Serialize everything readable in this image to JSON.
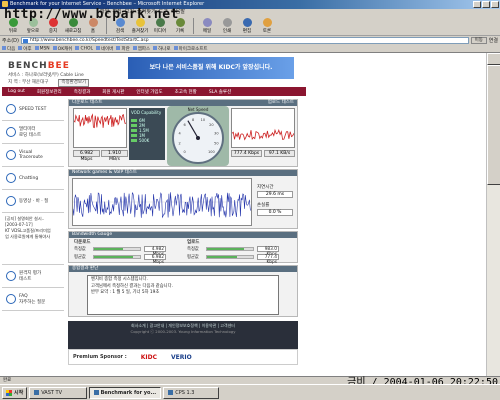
{
  "window": {
    "title": "Benchmark for your Internet Service – Benchbee – Microsoft Internet Explorer"
  },
  "watermark": "http://www.bcpark.net",
  "menu": [
    "파일",
    "편집",
    "보기",
    "즐겨찾기",
    "도구",
    "도움말"
  ],
  "toolbar": [
    "뒤로",
    "앞으로",
    "중지",
    "새로고침",
    "홈",
    "검색",
    "즐겨찾기",
    "미디어",
    "기록",
    "메일",
    "인쇄",
    "편집",
    "토론"
  ],
  "address": {
    "label": "주소(D)",
    "url": "http://www.benchbee.co.kr/Speedtest/TestStartC.asp",
    "go": "이동",
    "links": "연결"
  },
  "links": [
    "다음",
    "야후",
    "MSN",
    "OK캐쉬",
    "CHOL",
    "네이버",
    "파란",
    "엠파스",
    "하나로",
    "마이크로소프트"
  ],
  "site": {
    "logo_a": "BENCH",
    "logo_b": "BEE",
    "info": [
      "서비스 : 하나로(보라넷/무) Cable Line",
      "지 역 : 부산 해운대구"
    ],
    "info_button": "측정환경보기",
    "banner": "보다 나은 서비스품질 위해 KIDC가 앞장섭니다."
  },
  "nav": [
    "Log out",
    "회원정보관리",
    "측정결과",
    "회원 게시판",
    "인터넷 가입도",
    "초고속 현황",
    "SLA 솔루션"
  ],
  "sidebar": [
    "SPEED TEST",
    "멀티미터\n로딩 테스트",
    "Visual\nTraceroute",
    "Chatting",
    "동영상 · 바 · 질",
    "원격지 평가\n테스트",
    "FAQ\n자주하는 질문"
  ],
  "news": [
    "[공지] 설명회안 설시..",
    "[2003-07-17]",
    "KT VDSL고품질/프리미엄",
    "업 사용료원에게 통해야사"
  ],
  "speed": {
    "download_title": "다운로드 테스트",
    "upload_title": "업로드 테스트",
    "download_mbps": "6.982 Mbps",
    "download_kbs": "1.910 MB/s",
    "upload_kbs": "777.4 Kbps",
    "upload_kbs2": "97.1 KB/s",
    "vod_title": "VOD Capability",
    "vod_levels": [
      "6M",
      "2M",
      "1.5M",
      "1M",
      "500K"
    ],
    "gauge_title": "Net Speed",
    "gauge_scale": [
      "0",
      "2",
      "4",
      "6",
      "8",
      "10",
      "20",
      "30",
      "50",
      "100"
    ],
    "gauge_value_mbps": 6.98
  },
  "jitter": {
    "title": "Network games & VoIP 테스트",
    "ping_label": "지연시간",
    "ping_value": "29.6 ms",
    "loss_label": "손실률",
    "loss_value": "0.0 %"
  },
  "bandwidth": {
    "title": "Bandwidth Gauge",
    "down_title": "다운로드",
    "up_title": "업로드",
    "down": [
      {
        "label": "측정값",
        "value": "4.982 Mbps",
        "pct": 0.62
      },
      {
        "label": "평균값",
        "value": "6.982 Mbps",
        "pct": 0.85
      }
    ],
    "up": [
      {
        "label": "측정값",
        "value": "983.0 Kbps",
        "pct": 0.8
      },
      {
        "label": "평균값",
        "value": "777.4 Kbps",
        "pct": 0.65
      }
    ]
  },
  "result": {
    "title": "종합결과 판단",
    "lines": [
      "벤치비 종합 측정 시스템입니다.",
      "고객님께서 측정하신 결과는 다음과 같습니다.",
      "",
      "반무 요약 :        1 월 5 일,  기너 5차 19초"
    ]
  },
  "footer": {
    "links": [
      "회사소개",
      "광고안내",
      "개인정보보호정책",
      "이용약관",
      "고객센터"
    ],
    "copyright": "Copyright ⓒ 2000-2003. Young Information Technology",
    "sponsor_label": "Premium Sponsor :",
    "sponsors": [
      "KIDC",
      "VERIO"
    ]
  },
  "status": "완료",
  "taskbar": {
    "start": "시작",
    "tasks": [
      "VAST TV",
      "Benchmark for yo...",
      "CPS 1.3"
    ]
  },
  "clock": "금비 / 2004-01-06 20:22:50"
}
